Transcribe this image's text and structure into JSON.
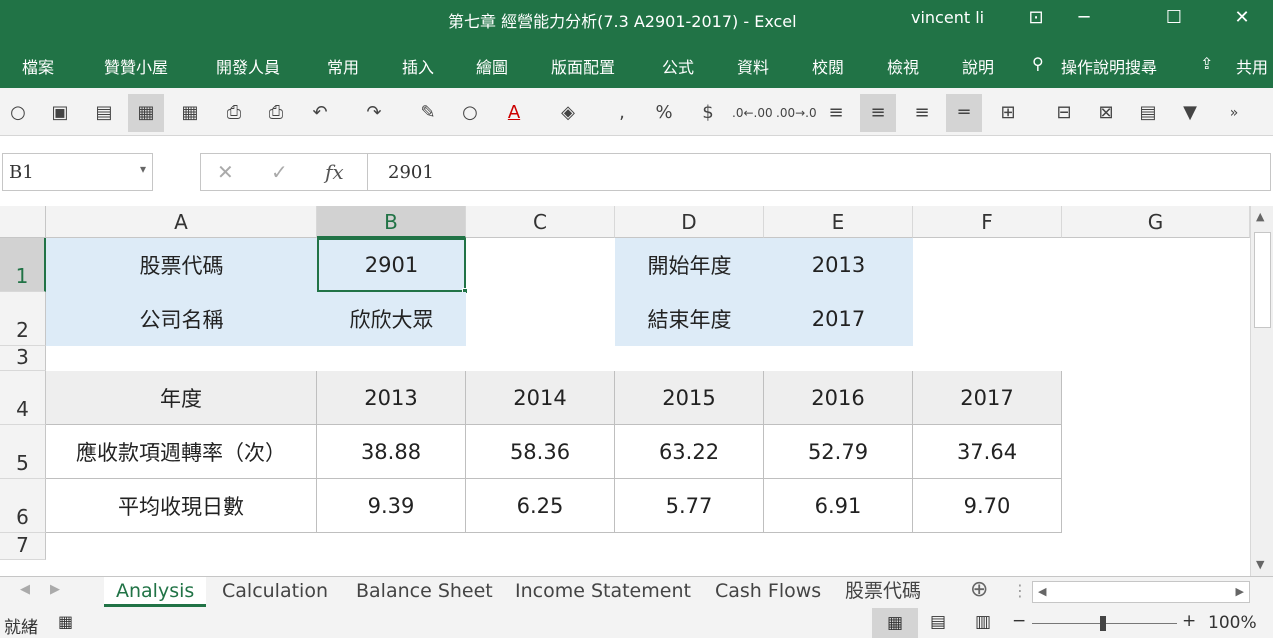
{
  "window": {
    "title": "第七章 經營能力分析(7.3 A2901-2017)  -  Excel",
    "user": "vincent li"
  },
  "menu": [
    "檔案",
    "贊贊小屋",
    "開發人員",
    "常用",
    "插入",
    "繪圖",
    "版面配置",
    "公式",
    "資料",
    "校閱",
    "檢視",
    "說明"
  ],
  "search_label": "操作說明搜尋",
  "share_label": "共用",
  "formula": {
    "name_box": "B1",
    "value": "2901",
    "fx": "fx"
  },
  "columns": [
    "A",
    "B",
    "C",
    "D",
    "E",
    "F",
    "G"
  ],
  "rows": [
    "1",
    "2",
    "3",
    "4",
    "5",
    "6",
    "7"
  ],
  "info": {
    "a1": "股票代碼",
    "b1": "2901",
    "a2": "公司名稱",
    "b2": "欣欣大眾",
    "d1": "開始年度",
    "e1": "2013",
    "d2": "結束年度",
    "e2": "2017"
  },
  "table": {
    "header": [
      "年度",
      "2013",
      "2014",
      "2015",
      "2016",
      "2017"
    ],
    "rows": [
      [
        "應收款項週轉率（次）",
        "38.88",
        "58.36",
        "63.22",
        "52.79",
        "37.64"
      ],
      [
        "平均收現日數",
        "9.39",
        "6.25",
        "5.77",
        "6.91",
        "9.70"
      ]
    ]
  },
  "sheets": [
    "Analysis",
    "Calculation",
    "Balance Sheet",
    "Income Statement",
    "Cash Flows",
    "股票代碼"
  ],
  "status": {
    "ready": "就緒",
    "zoom": "100%"
  },
  "colors": {
    "brand": "#217346",
    "info_fill": "#ddebf7",
    "header_fill": "#eeeeee"
  }
}
